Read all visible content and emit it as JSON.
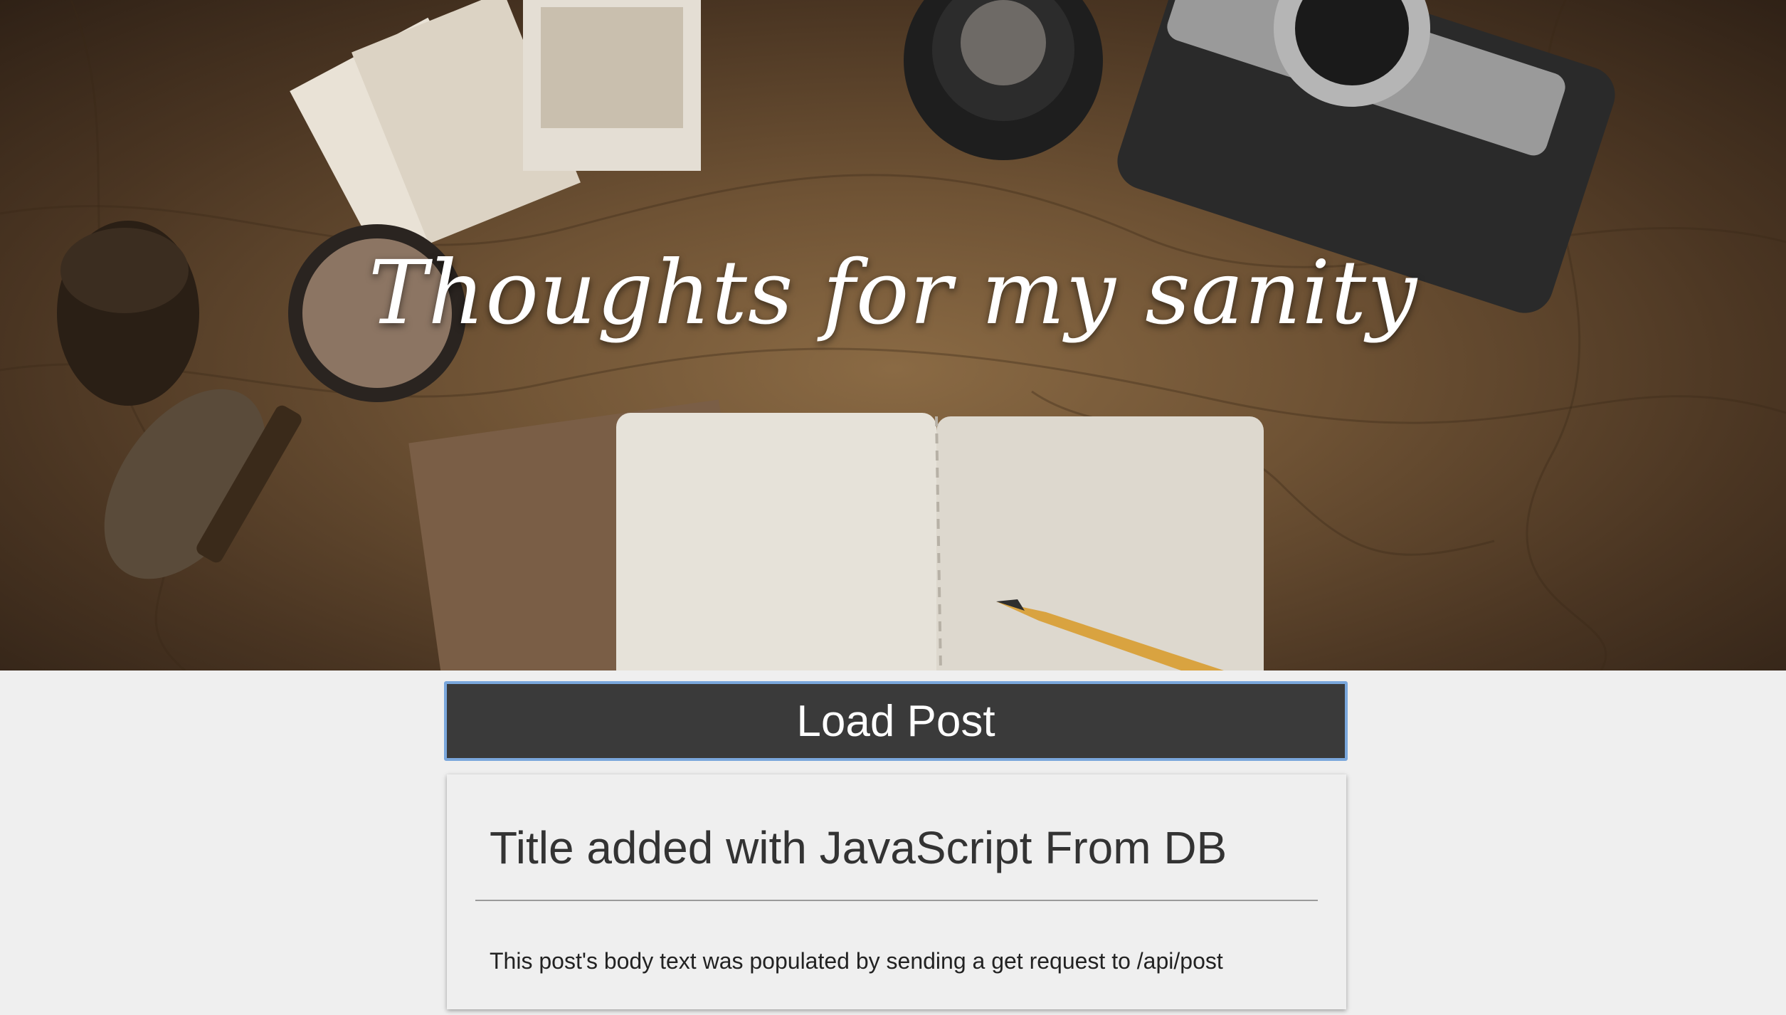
{
  "header": {
    "title": "Thoughts for my sanity"
  },
  "actions": {
    "load_post_label": "Load Post"
  },
  "post": {
    "title": "Title added with JavaScript From DB",
    "body": "This post's body text was populated by sending a get request to /api/post"
  },
  "colors": {
    "button_bg": "#3a3a3a",
    "button_focus_border": "#7aa7dc",
    "page_bg": "#efefef"
  }
}
